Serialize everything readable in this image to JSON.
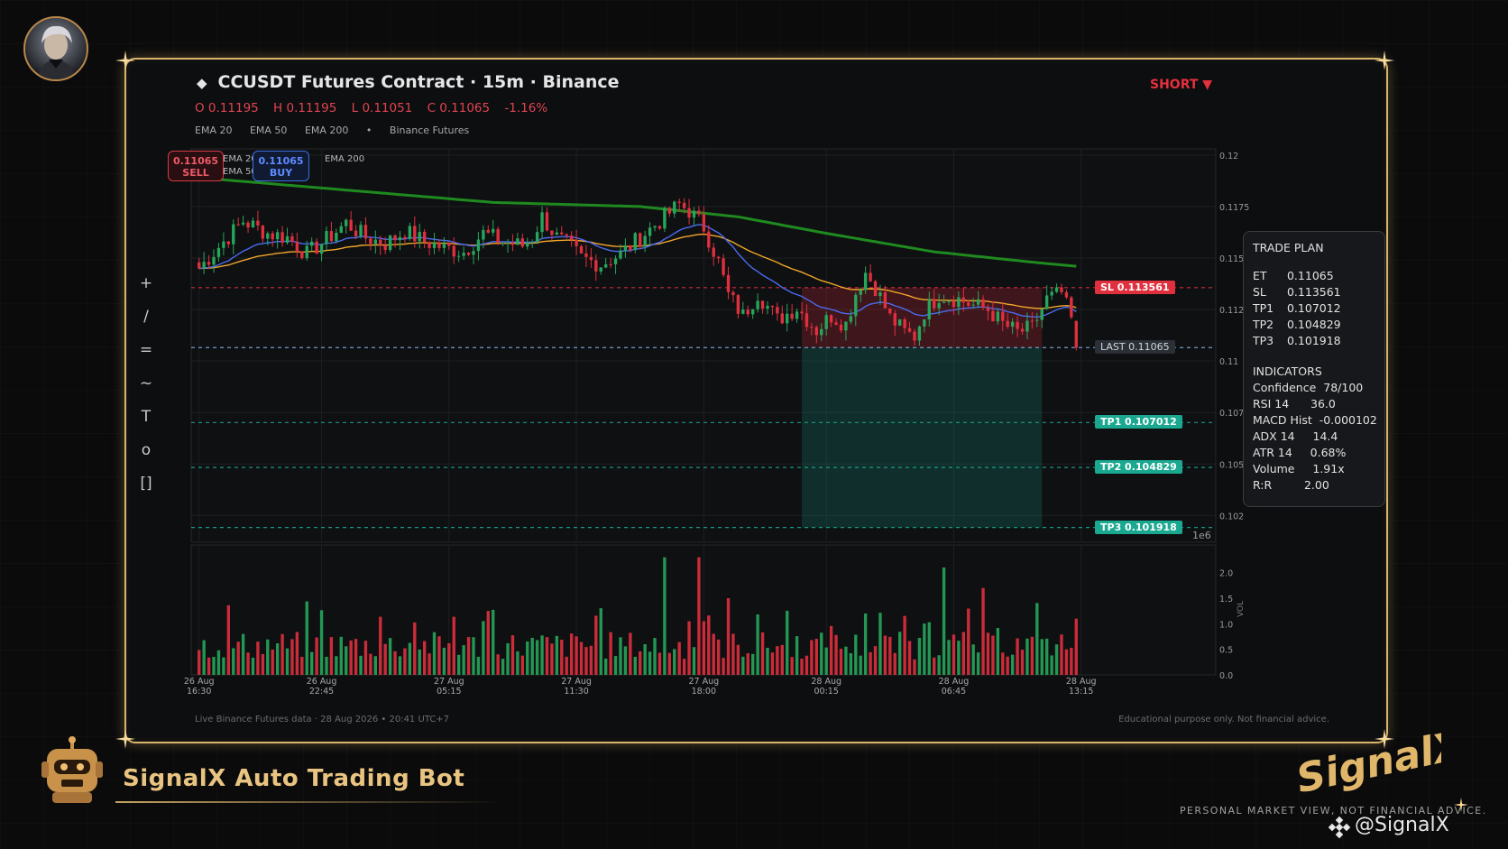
{
  "header": {
    "title": "CCUSDT Futures Contract  ·  15m  ·  Binance",
    "ohlc": {
      "open": "O 0.11195",
      "high": "H 0.11195",
      "low": "L 0.11051",
      "close": "C 0.11065",
      "change": "-1.16%"
    },
    "indicators": [
      "EMA 20",
      "EMA 50",
      "EMA 200",
      "•",
      "Binance Futures"
    ],
    "side": "SHORT ▼"
  },
  "quick_trade": {
    "sell_price": "0.11065",
    "sell_label": "SELL",
    "buy_price": "0.11065",
    "buy_label": "BUY",
    "legend_1": "EMA 20",
    "legend_2": "EMA 50",
    "legend_3": "EMA 200"
  },
  "toolbar": [
    "+",
    "/",
    "=",
    "~",
    "T",
    "o",
    "[]"
  ],
  "trade_plan": {
    "title": "TRADE PLAN",
    "levels": [
      {
        "k": "ET",
        "v": "0.11065"
      },
      {
        "k": "SL",
        "v": "0.113561"
      },
      {
        "k": "TP1",
        "v": "0.107012"
      },
      {
        "k": "TP2",
        "v": "0.104829"
      },
      {
        "k": "TP3",
        "v": "0.101918"
      }
    ],
    "ind_title": "INDICATORS",
    "indicators": [
      {
        "k": "Confidence",
        "v": "78/100"
      },
      {
        "k": "RSI 14",
        "v": "36.0"
      },
      {
        "k": "MACD Hist",
        "v": "-0.000102"
      },
      {
        "k": "ADX 14",
        "v": "14.4"
      },
      {
        "k": "ATR 14",
        "v": "0.68%"
      },
      {
        "k": "Volume",
        "v": "1.91x"
      },
      {
        "k": "R:R",
        "v": "2.00"
      }
    ]
  },
  "colors": {
    "bull": "#26a65b",
    "bear": "#e0303e",
    "ema20": "#4a6cf0",
    "ema50": "#f2a62a",
    "ema200": "#1f8a1f",
    "sl": "#e0303e",
    "tp": "#1aa890",
    "last": "#7fa9d8",
    "gold": "#d9b46a"
  },
  "chart_data": {
    "type": "candlestick",
    "interval": "15m",
    "candle_count": 180,
    "x_tick_labels": [
      {
        "d": "26 Aug",
        "t": "16:30"
      },
      {
        "d": "26 Aug",
        "t": "22:45"
      },
      {
        "d": "27 Aug",
        "t": "05:15"
      },
      {
        "d": "27 Aug",
        "t": "11:30"
      },
      {
        "d": "27 Aug",
        "t": "18:00"
      },
      {
        "d": "28 Aug",
        "t": "00:15"
      },
      {
        "d": "28 Aug",
        "t": "06:45"
      },
      {
        "d": "28 Aug",
        "t": "13:15"
      }
    ],
    "x_tick_index": [
      0,
      25,
      51,
      77,
      103,
      128,
      154,
      180
    ],
    "y_ticks": [
      "0.12",
      "0.1175",
      "0.115",
      "0.112",
      "0.11",
      "0.107",
      "0.105",
      "0.102"
    ],
    "y_tick_values": [
      0.12,
      0.1175,
      0.115,
      0.1125,
      0.11,
      0.1075,
      0.105,
      0.1025
    ],
    "ylim": [
      0.1012,
      0.1203
    ],
    "y_offset_label": "1e6",
    "volume_ticks": [
      "2.0",
      "1.5",
      "1.0",
      "0.5",
      "0.0"
    ],
    "volume_tick_values": [
      2.0,
      1.5,
      1.0,
      0.5,
      0.0
    ],
    "volume_ylim": [
      0,
      2.4
    ],
    "volume_label": "VOL",
    "levels": {
      "sl": {
        "label": "SL  0.113561",
        "value": 0.113561
      },
      "last": {
        "label": "LAST  0.11065",
        "value": 0.11065
      },
      "tp1": {
        "label": "TP1  0.107012",
        "value": 0.107012
      },
      "tp2": {
        "label": "TP2  0.104829",
        "value": 0.104829
      },
      "tp3": {
        "label": "TP3  0.101918",
        "value": 0.101918
      }
    },
    "zone_start_index": 123,
    "zone_end_index": 172,
    "anchor_points": [
      [
        0,
        0.1145
      ],
      [
        5,
        0.1158
      ],
      [
        9,
        0.1168
      ],
      [
        14,
        0.1162
      ],
      [
        18,
        0.116
      ],
      [
        22,
        0.1152
      ],
      [
        26,
        0.1159
      ],
      [
        30,
        0.1167
      ],
      [
        34,
        0.116
      ],
      [
        38,
        0.1157
      ],
      [
        42,
        0.1163
      ],
      [
        46,
        0.1158
      ],
      [
        50,
        0.1155
      ],
      [
        54,
        0.1153
      ],
      [
        58,
        0.1162
      ],
      [
        62,
        0.1158
      ],
      [
        66,
        0.1156
      ],
      [
        68,
        0.116
      ],
      [
        70,
        0.117
      ],
      [
        73,
        0.116
      ],
      [
        76,
        0.1155
      ],
      [
        78,
        0.115
      ],
      [
        82,
        0.1147
      ],
      [
        86,
        0.1152
      ],
      [
        90,
        0.116
      ],
      [
        94,
        0.1168
      ],
      [
        98,
        0.1176
      ],
      [
        100,
        0.1173
      ],
      [
        103,
        0.1165
      ],
      [
        106,
        0.1148
      ],
      [
        108,
        0.1132
      ],
      [
        111,
        0.1122
      ],
      [
        114,
        0.1133
      ],
      [
        118,
        0.112
      ],
      [
        122,
        0.1126
      ],
      [
        126,
        0.1115
      ],
      [
        129,
        0.1122
      ],
      [
        132,
        0.1118
      ],
      [
        134,
        0.1133
      ],
      [
        136,
        0.1143
      ],
      [
        138,
        0.1136
      ],
      [
        141,
        0.1121
      ],
      [
        144,
        0.1114
      ],
      [
        146,
        0.1112
      ],
      [
        148,
        0.1124
      ],
      [
        151,
        0.1132
      ],
      [
        155,
        0.113
      ],
      [
        158,
        0.1127
      ],
      [
        161,
        0.1125
      ],
      [
        164,
        0.1118
      ],
      [
        167,
        0.1114
      ],
      [
        170,
        0.1116
      ],
      [
        173,
        0.113
      ],
      [
        176,
        0.1133
      ],
      [
        178,
        0.112
      ],
      [
        179,
        0.11065
      ]
    ],
    "ema200_points": [
      [
        0,
        0.1189
      ],
      [
        30,
        0.1183
      ],
      [
        60,
        0.1177
      ],
      [
        90,
        0.1175
      ],
      [
        110,
        0.117
      ],
      [
        128,
        0.1162
      ],
      [
        150,
        0.1153
      ],
      [
        170,
        0.1148
      ],
      [
        179,
        0.1146
      ]
    ]
  },
  "footer": {
    "left": "Live Binance Futures data  ·  28 Aug 2026 • 20:41 UTC+7",
    "right": "Educational purpose only. Not financial advice."
  },
  "branding": {
    "bot_name": "SignalX Auto Trading Bot",
    "logo_text": "SignalX",
    "disclaimer": "PERSONAL MARKET VIEW, NOT FINANCIAL ADVICE.",
    "handle": "@SignalX"
  }
}
